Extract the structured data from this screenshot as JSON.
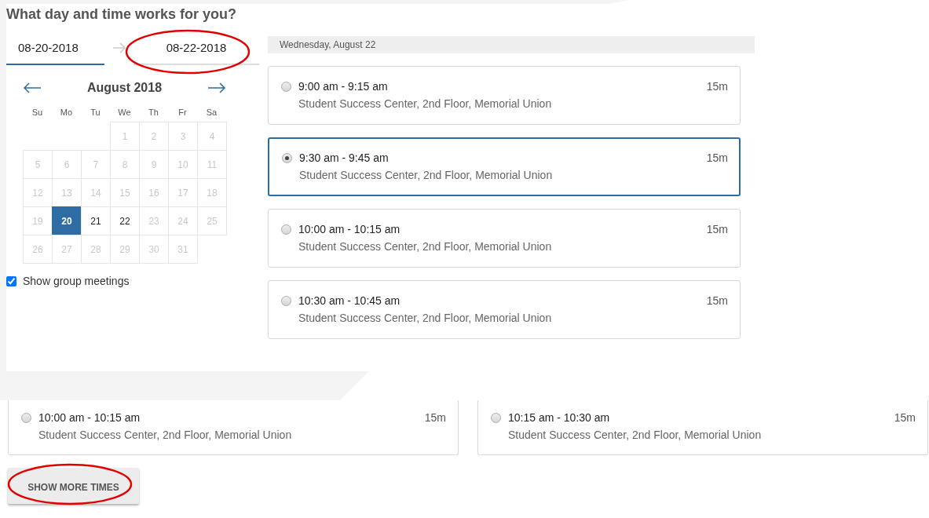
{
  "title": "What day and time works for you?",
  "start_date": {
    "value": "08-20-2018",
    "selected": true,
    "circled": false
  },
  "end_date": {
    "value": "08-22-2018",
    "selected": false,
    "circled": true
  },
  "calendar": {
    "month": "August 2018",
    "weekdays": [
      "Su",
      "Mo",
      "Tu",
      "We",
      "Th",
      "Fr",
      "Sa"
    ],
    "weeks": [
      [
        {
          "day": "1",
          "disabled": true,
          "selected": false
        },
        {
          "day": "2",
          "disabled": true,
          "selected": false
        },
        {
          "day": "3",
          "disabled": true,
          "selected": false
        },
        {
          "day": "4",
          "disabled": true,
          "selected": false
        }
      ],
      [
        {
          "day": "5",
          "disabled": true,
          "selected": false
        },
        {
          "day": "6",
          "disabled": true,
          "selected": false
        },
        {
          "day": "7",
          "disabled": true,
          "selected": false
        },
        {
          "day": "8",
          "disabled": true,
          "selected": false
        },
        {
          "day": "9",
          "disabled": true,
          "selected": false
        },
        {
          "day": "10",
          "disabled": true,
          "selected": false
        },
        {
          "day": "11",
          "disabled": true,
          "selected": false
        }
      ],
      [
        {
          "day": "12",
          "disabled": true,
          "selected": false
        },
        {
          "day": "13",
          "disabled": true,
          "selected": false
        },
        {
          "day": "14",
          "disabled": true,
          "selected": false
        },
        {
          "day": "15",
          "disabled": true,
          "selected": false
        },
        {
          "day": "16",
          "disabled": true,
          "selected": false
        },
        {
          "day": "17",
          "disabled": true,
          "selected": false
        },
        {
          "day": "18",
          "disabled": true,
          "selected": false
        }
      ],
      [
        {
          "day": "19",
          "disabled": true,
          "selected": false
        },
        {
          "day": "20",
          "disabled": false,
          "selected": true
        },
        {
          "day": "21",
          "disabled": false,
          "selected": false
        },
        {
          "day": "22",
          "disabled": false,
          "selected": false
        },
        {
          "day": "23",
          "disabled": true,
          "selected": false
        },
        {
          "day": "24",
          "disabled": true,
          "selected": false
        },
        {
          "day": "25",
          "disabled": true,
          "selected": false
        }
      ],
      [
        {
          "day": "26",
          "disabled": true,
          "selected": false
        },
        {
          "day": "27",
          "disabled": true,
          "selected": false
        },
        {
          "day": "28",
          "disabled": true,
          "selected": false
        },
        {
          "day": "29",
          "disabled": true,
          "selected": false
        },
        {
          "day": "30",
          "disabled": true,
          "selected": false
        },
        {
          "day": "31",
          "disabled": true,
          "selected": false
        }
      ]
    ]
  },
  "show_group_meetings": {
    "label": "Show group meetings",
    "checked": true
  },
  "day_header": "Wednesday, August 22",
  "slots": [
    {
      "time": "9:00 am - 9:15 am",
      "location": "Student Success Center, 2nd Floor, Memorial Union",
      "duration": "15m",
      "selected": false
    },
    {
      "time": "9:30 am - 9:45 am",
      "location": "Student Success Center, 2nd Floor, Memorial Union",
      "duration": "15m",
      "selected": true
    },
    {
      "time": "10:00 am - 10:15 am",
      "location": "Student Success Center, 2nd Floor, Memorial Union",
      "duration": "15m",
      "selected": false
    },
    {
      "time": "10:30 am - 10:45 am",
      "location": "Student Success Center, 2nd Floor, Memorial Union",
      "duration": "15m",
      "selected": false
    }
  ],
  "lower_slots": [
    {
      "time": "10:00 am - 10:15 am",
      "location": "Student Success Center, 2nd Floor, Memorial Union",
      "duration": "15m",
      "selected": false
    },
    {
      "time": "10:15 am - 10:30 am",
      "location": "Student Success Center, 2nd Floor, Memorial Union",
      "duration": "15m",
      "selected": false
    }
  ],
  "show_more_button": {
    "label": "SHOW MORE TIMES",
    "circled": true
  }
}
